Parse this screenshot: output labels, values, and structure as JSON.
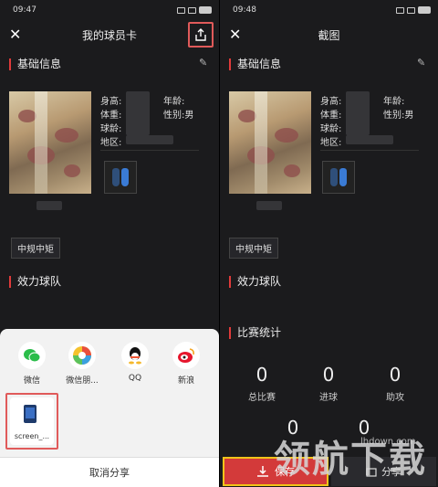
{
  "left": {
    "time": "09:47",
    "title": "我的球员卡",
    "section_basic": "基础信息",
    "label_height": "身高:",
    "label_weight": "体重:",
    "label_age_exp": "球龄:",
    "label_region": "地区:",
    "label_age": "年龄:",
    "label_gender": "性别:男",
    "position_tag": "中规中矩",
    "section_team": "效力球队",
    "share_options": [
      {
        "label": "微信",
        "icon": "wechat-icon"
      },
      {
        "label": "微信朋...",
        "icon": "moments-icon"
      },
      {
        "label": "QQ",
        "icon": "qq-icon"
      },
      {
        "label": "新浪",
        "icon": "weibo-icon"
      }
    ],
    "file_label": "screen_...",
    "cancel": "取消分享"
  },
  "right": {
    "time": "09:48",
    "title": "截图",
    "section_basic": "基础信息",
    "label_height": "身高:",
    "label_weight": "体重:",
    "label_age_exp": "球龄:",
    "label_region": "地区:",
    "label_age": "年龄:",
    "label_gender": "性别:男",
    "position_tag": "中规中矩",
    "section_team": "效力球队",
    "section_stats": "比赛统计",
    "stats": [
      {
        "value": "0",
        "label": "总比赛"
      },
      {
        "value": "0",
        "label": "进球"
      },
      {
        "value": "0",
        "label": "助攻"
      },
      {
        "value": "0",
        "label": ""
      },
      {
        "value": "0",
        "label": ""
      }
    ],
    "save": "保存",
    "share": "分享"
  },
  "watermark": "领航下载",
  "watermark_url": "lhdown.com",
  "colors": {
    "accent": "#e03a3a",
    "highlight_yellow": "#f0c419",
    "highlight_red": "#e05a5a"
  }
}
